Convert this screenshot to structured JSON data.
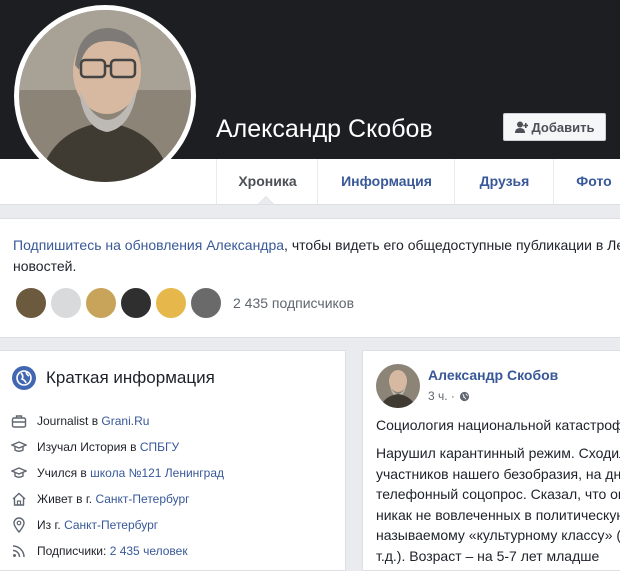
{
  "profile": {
    "name": "Александр Скобов",
    "add_friend_label": "Добавить"
  },
  "tabs": [
    {
      "label": "Хроника",
      "active": true
    },
    {
      "label": "Информация"
    },
    {
      "label": "Друзья"
    },
    {
      "label": "Фото"
    }
  ],
  "follow": {
    "link_text": "Подпишитесь на обновления Александра",
    "rest_line1": ", чтобы видеть его общедоступные публикации в Ленте",
    "line2": "новостей.",
    "followers_count": "2 435 подписчиков"
  },
  "intro": {
    "title": "Краткая информация",
    "rows": [
      {
        "icon": "briefcase-icon",
        "prefix": "Journalist в ",
        "link": "Grani.Ru"
      },
      {
        "icon": "graduation-cap-icon",
        "prefix": "Изучал История в ",
        "link": "СПБГУ"
      },
      {
        "icon": "graduation-cap-icon",
        "prefix": "Учился в ",
        "link": "школа №121 Ленинград"
      },
      {
        "icon": "home-icon",
        "prefix": "Живет в г. ",
        "link": "Санкт-Петербург"
      },
      {
        "icon": "location-pin-icon",
        "prefix": "Из г. ",
        "link": "Санкт-Петербург"
      },
      {
        "icon": "rss-icon",
        "prefix": "Подписчики: ",
        "link": "2 435 человек"
      }
    ]
  },
  "post": {
    "author": "Александр Скобов",
    "time": "3 ч. ·",
    "headline": "Социология национальной катастрофы",
    "lines": [
      "Нарушил карантинный режим. Сходил к одному из",
      "участников нашего безобразия, на днях провёл",
      "телефонный соцопрос. Сказал, что опрошенные –",
      "никак не вовлеченных в политическую жизнь, по",
      "называемому «культурному классу» (кинозрители и",
      "т.д.). Возраст – на 5-7 лет младше"
    ]
  },
  "colors": {
    "cover": "#1c1e21",
    "link": "#385898",
    "background": "#e9ebee"
  }
}
